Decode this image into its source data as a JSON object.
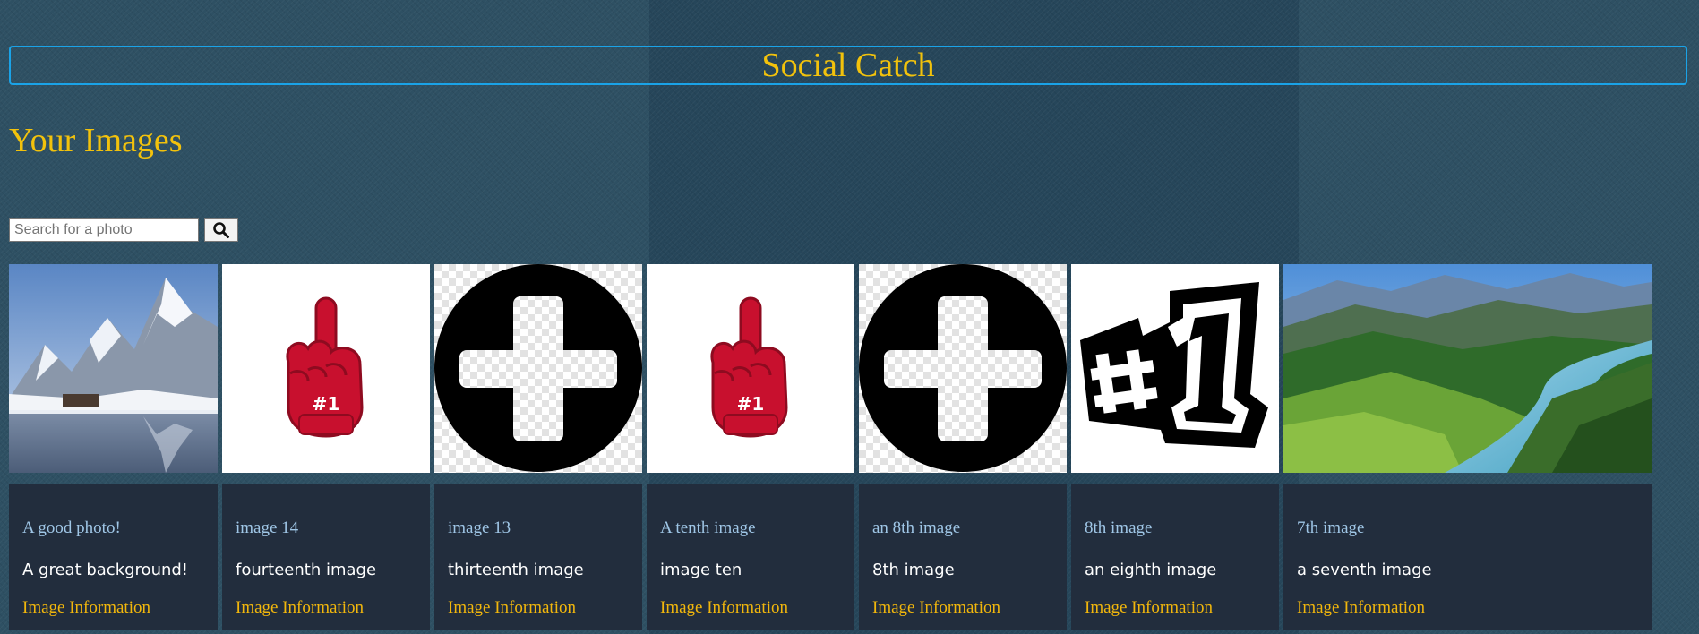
{
  "header": {
    "title": "Social Catch"
  },
  "page": {
    "heading": "Your Images"
  },
  "search": {
    "placeholder": "Search for a photo",
    "button_icon": "search-icon"
  },
  "cards": [
    {
      "title": "A good photo!",
      "description": "A great background!",
      "link": "Image Information",
      "image": "snowy-mountain-lake"
    },
    {
      "title": "image 14",
      "description": "fourteenth image",
      "link": "Image Information",
      "image": "foam-finger-number-one"
    },
    {
      "title": "image 13",
      "description": "thirteenth image",
      "link": "Image Information",
      "image": "plus-circle"
    },
    {
      "title": "A tenth image",
      "description": "image ten",
      "link": "Image Information",
      "image": "foam-finger-number-one"
    },
    {
      "title": "an 8th image",
      "description": "8th image",
      "link": "Image Information",
      "image": "plus-circle"
    },
    {
      "title": "8th image",
      "description": "an eighth image",
      "link": "Image Information",
      "image": "number-one-badge"
    },
    {
      "title": "7th image",
      "description": "a seventh image",
      "link": "Image Information",
      "image": "river-valley-landscape"
    }
  ],
  "colors": {
    "accent": "#f2c20c",
    "header_border": "#1aa3e8",
    "card_bg": "#222d3d",
    "card_title": "#9fc6e6",
    "link": "#f2b70c"
  }
}
